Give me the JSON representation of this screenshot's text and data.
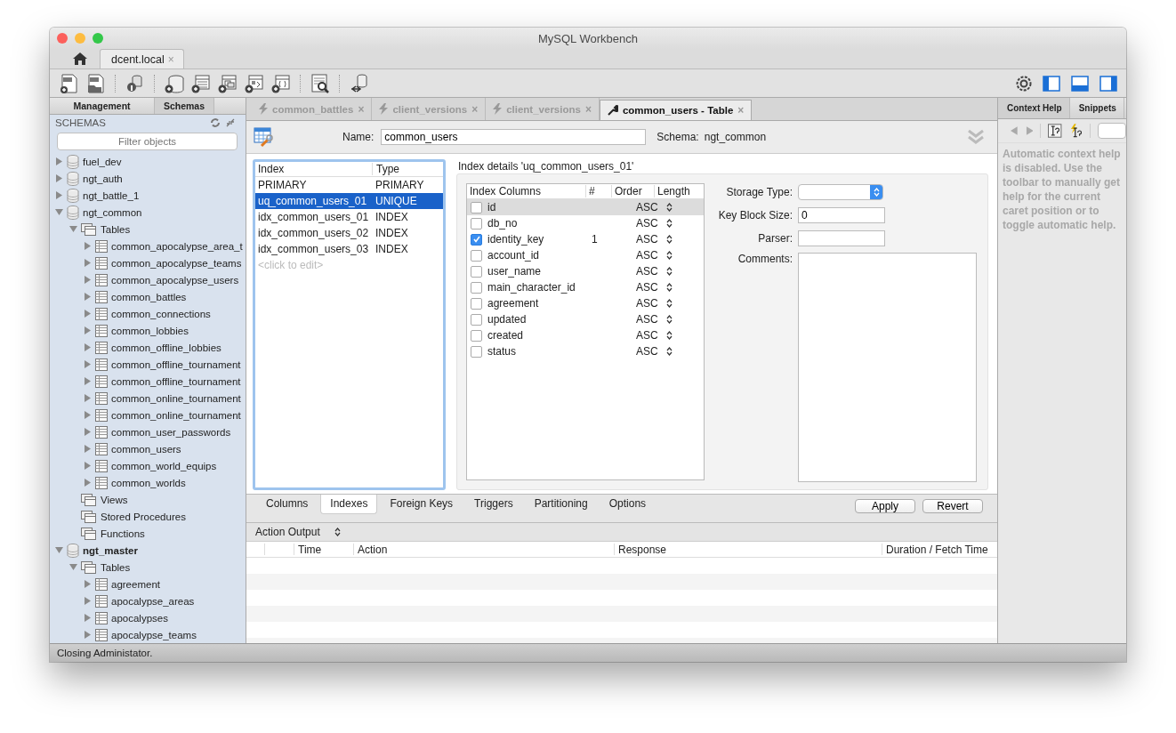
{
  "window": {
    "title": "MySQL Workbench"
  },
  "connection_tabs": [
    {
      "label": "dcent.local",
      "close": "×",
      "selected": true
    }
  ],
  "sidebar": {
    "tabs": [
      {
        "label": "Management",
        "selected": false
      },
      {
        "label": "Schemas",
        "selected": true
      }
    ],
    "heading": "SCHEMAS",
    "filter": {
      "placeholder": "Filter objects"
    },
    "tree": [
      {
        "label": "fuel_dev",
        "kind": "schema",
        "expanded": false,
        "default_schema": false
      },
      {
        "label": "ngt_auth",
        "kind": "schema",
        "expanded": false,
        "default_schema": false
      },
      {
        "label": "ngt_battle_1",
        "kind": "schema",
        "expanded": false,
        "default_schema": false
      },
      {
        "label": "ngt_common",
        "kind": "schema",
        "expanded": true,
        "default_schema": false,
        "children": [
          {
            "label": "Tables",
            "kind": "folder",
            "expanded": true,
            "children": [
              {
                "label": "common_apocalypse_area_t",
                "kind": "table",
                "expanded": false
              },
              {
                "label": "common_apocalypse_teams",
                "kind": "table",
                "expanded": false
              },
              {
                "label": "common_apocalypse_users",
                "kind": "table",
                "expanded": false
              },
              {
                "label": "common_battles",
                "kind": "table",
                "expanded": false
              },
              {
                "label": "common_connections",
                "kind": "table",
                "expanded": false
              },
              {
                "label": "common_lobbies",
                "kind": "table",
                "expanded": false
              },
              {
                "label": "common_offline_lobbies",
                "kind": "table",
                "expanded": false
              },
              {
                "label": "common_offline_tournament",
                "kind": "table",
                "expanded": false
              },
              {
                "label": "common_offline_tournament",
                "kind": "table",
                "expanded": false
              },
              {
                "label": "common_online_tournament",
                "kind": "table",
                "expanded": false
              },
              {
                "label": "common_online_tournament",
                "kind": "table",
                "expanded": false
              },
              {
                "label": "common_user_passwords",
                "kind": "table",
                "expanded": false
              },
              {
                "label": "common_users",
                "kind": "table",
                "expanded": false
              },
              {
                "label": "common_world_equips",
                "kind": "table",
                "expanded": false
              },
              {
                "label": "common_worlds",
                "kind": "table",
                "expanded": false
              }
            ]
          },
          {
            "label": "Views",
            "kind": "folder"
          },
          {
            "label": "Stored Procedures",
            "kind": "folder"
          },
          {
            "label": "Functions",
            "kind": "folder"
          }
        ]
      },
      {
        "label": "ngt_master",
        "kind": "schema",
        "expanded": true,
        "default_schema": true,
        "children": [
          {
            "label": "Tables",
            "kind": "folder",
            "expanded": true,
            "children": [
              {
                "label": "agreement",
                "kind": "table",
                "expanded": false
              },
              {
                "label": "apocalypse_areas",
                "kind": "table",
                "expanded": false
              },
              {
                "label": "apocalypses",
                "kind": "table",
                "expanded": false
              },
              {
                "label": "apocalypse_teams",
                "kind": "table",
                "expanded": false
              }
            ]
          }
        ]
      }
    ]
  },
  "editor_tabs": [
    {
      "label": "common_battles",
      "close": "×",
      "kind": "query",
      "selected": false
    },
    {
      "label": "client_versions",
      "close": "×",
      "kind": "query",
      "selected": false
    },
    {
      "label": "client_versions",
      "close": "×",
      "kind": "query",
      "selected": false
    },
    {
      "label": "common_users - Table",
      "close": "×",
      "kind": "table",
      "selected": true
    }
  ],
  "table_editor": {
    "name_label": "Name:",
    "name": "common_users",
    "schema_label": "Schema:",
    "schema": "ngt_common",
    "index_list": {
      "columns": [
        "Index",
        "Type"
      ],
      "rows": [
        {
          "name": "PRIMARY",
          "type": "PRIMARY",
          "selected": false
        },
        {
          "name": "uq_common_users_01",
          "type": "UNIQUE",
          "selected": true
        },
        {
          "name": "idx_common_users_01",
          "type": "INDEX",
          "selected": false
        },
        {
          "name": "idx_common_users_02",
          "type": "INDEX",
          "selected": false
        },
        {
          "name": "idx_common_users_03",
          "type": "INDEX",
          "selected": false
        }
      ],
      "placeholder": "<click to edit>"
    },
    "details_title": "Index details 'uq_common_users_01'",
    "index_columns": {
      "columns": [
        "Index Columns",
        "#",
        "Order",
        "Length"
      ],
      "rows": [
        {
          "name": "id",
          "checked": false,
          "order": "ASC",
          "selected": true
        },
        {
          "name": "db_no",
          "checked": false,
          "order": "ASC",
          "selected": false
        },
        {
          "name": "identity_key",
          "checked": true,
          "number": "1",
          "order": "ASC",
          "selected": false
        },
        {
          "name": "account_id",
          "checked": false,
          "order": "ASC",
          "selected": false
        },
        {
          "name": "user_name",
          "checked": false,
          "order": "ASC",
          "selected": false
        },
        {
          "name": "main_character_id",
          "checked": false,
          "order": "ASC",
          "selected": false
        },
        {
          "name": "agreement",
          "checked": false,
          "order": "ASC",
          "selected": false
        },
        {
          "name": "updated",
          "checked": false,
          "order": "ASC",
          "selected": false
        },
        {
          "name": "created",
          "checked": false,
          "order": "ASC",
          "selected": false
        },
        {
          "name": "status",
          "checked": false,
          "order": "ASC",
          "selected": false
        }
      ]
    },
    "options": [
      {
        "label": "Storage Type:",
        "kind": "select"
      },
      {
        "label": "Key Block Size:",
        "kind": "text",
        "value": "0"
      },
      {
        "label": "Parser:",
        "kind": "text"
      },
      {
        "label": "Comments:",
        "kind": "textarea"
      }
    ],
    "tabs": [
      {
        "label": "Columns",
        "selected": false
      },
      {
        "label": "Indexes",
        "selected": true
      },
      {
        "label": "Foreign Keys",
        "selected": false
      },
      {
        "label": "Triggers",
        "selected": false
      },
      {
        "label": "Partitioning",
        "selected": false
      },
      {
        "label": "Options",
        "selected": false
      }
    ],
    "buttons": [
      "Apply",
      "Revert"
    ]
  },
  "output": {
    "selector": "Action Output",
    "columns": [
      "Time",
      "Action",
      "Response",
      "Duration / Fetch Time"
    ]
  },
  "context_panel": {
    "tabs": [
      {
        "label": "Context Help",
        "selected": true
      },
      {
        "label": "Snippets",
        "selected": false
      }
    ],
    "message": "Automatic context help is disabled. Use the toolbar to manually get help for the current caret position or to toggle automatic help."
  },
  "status_bar": "Closing Administator."
}
